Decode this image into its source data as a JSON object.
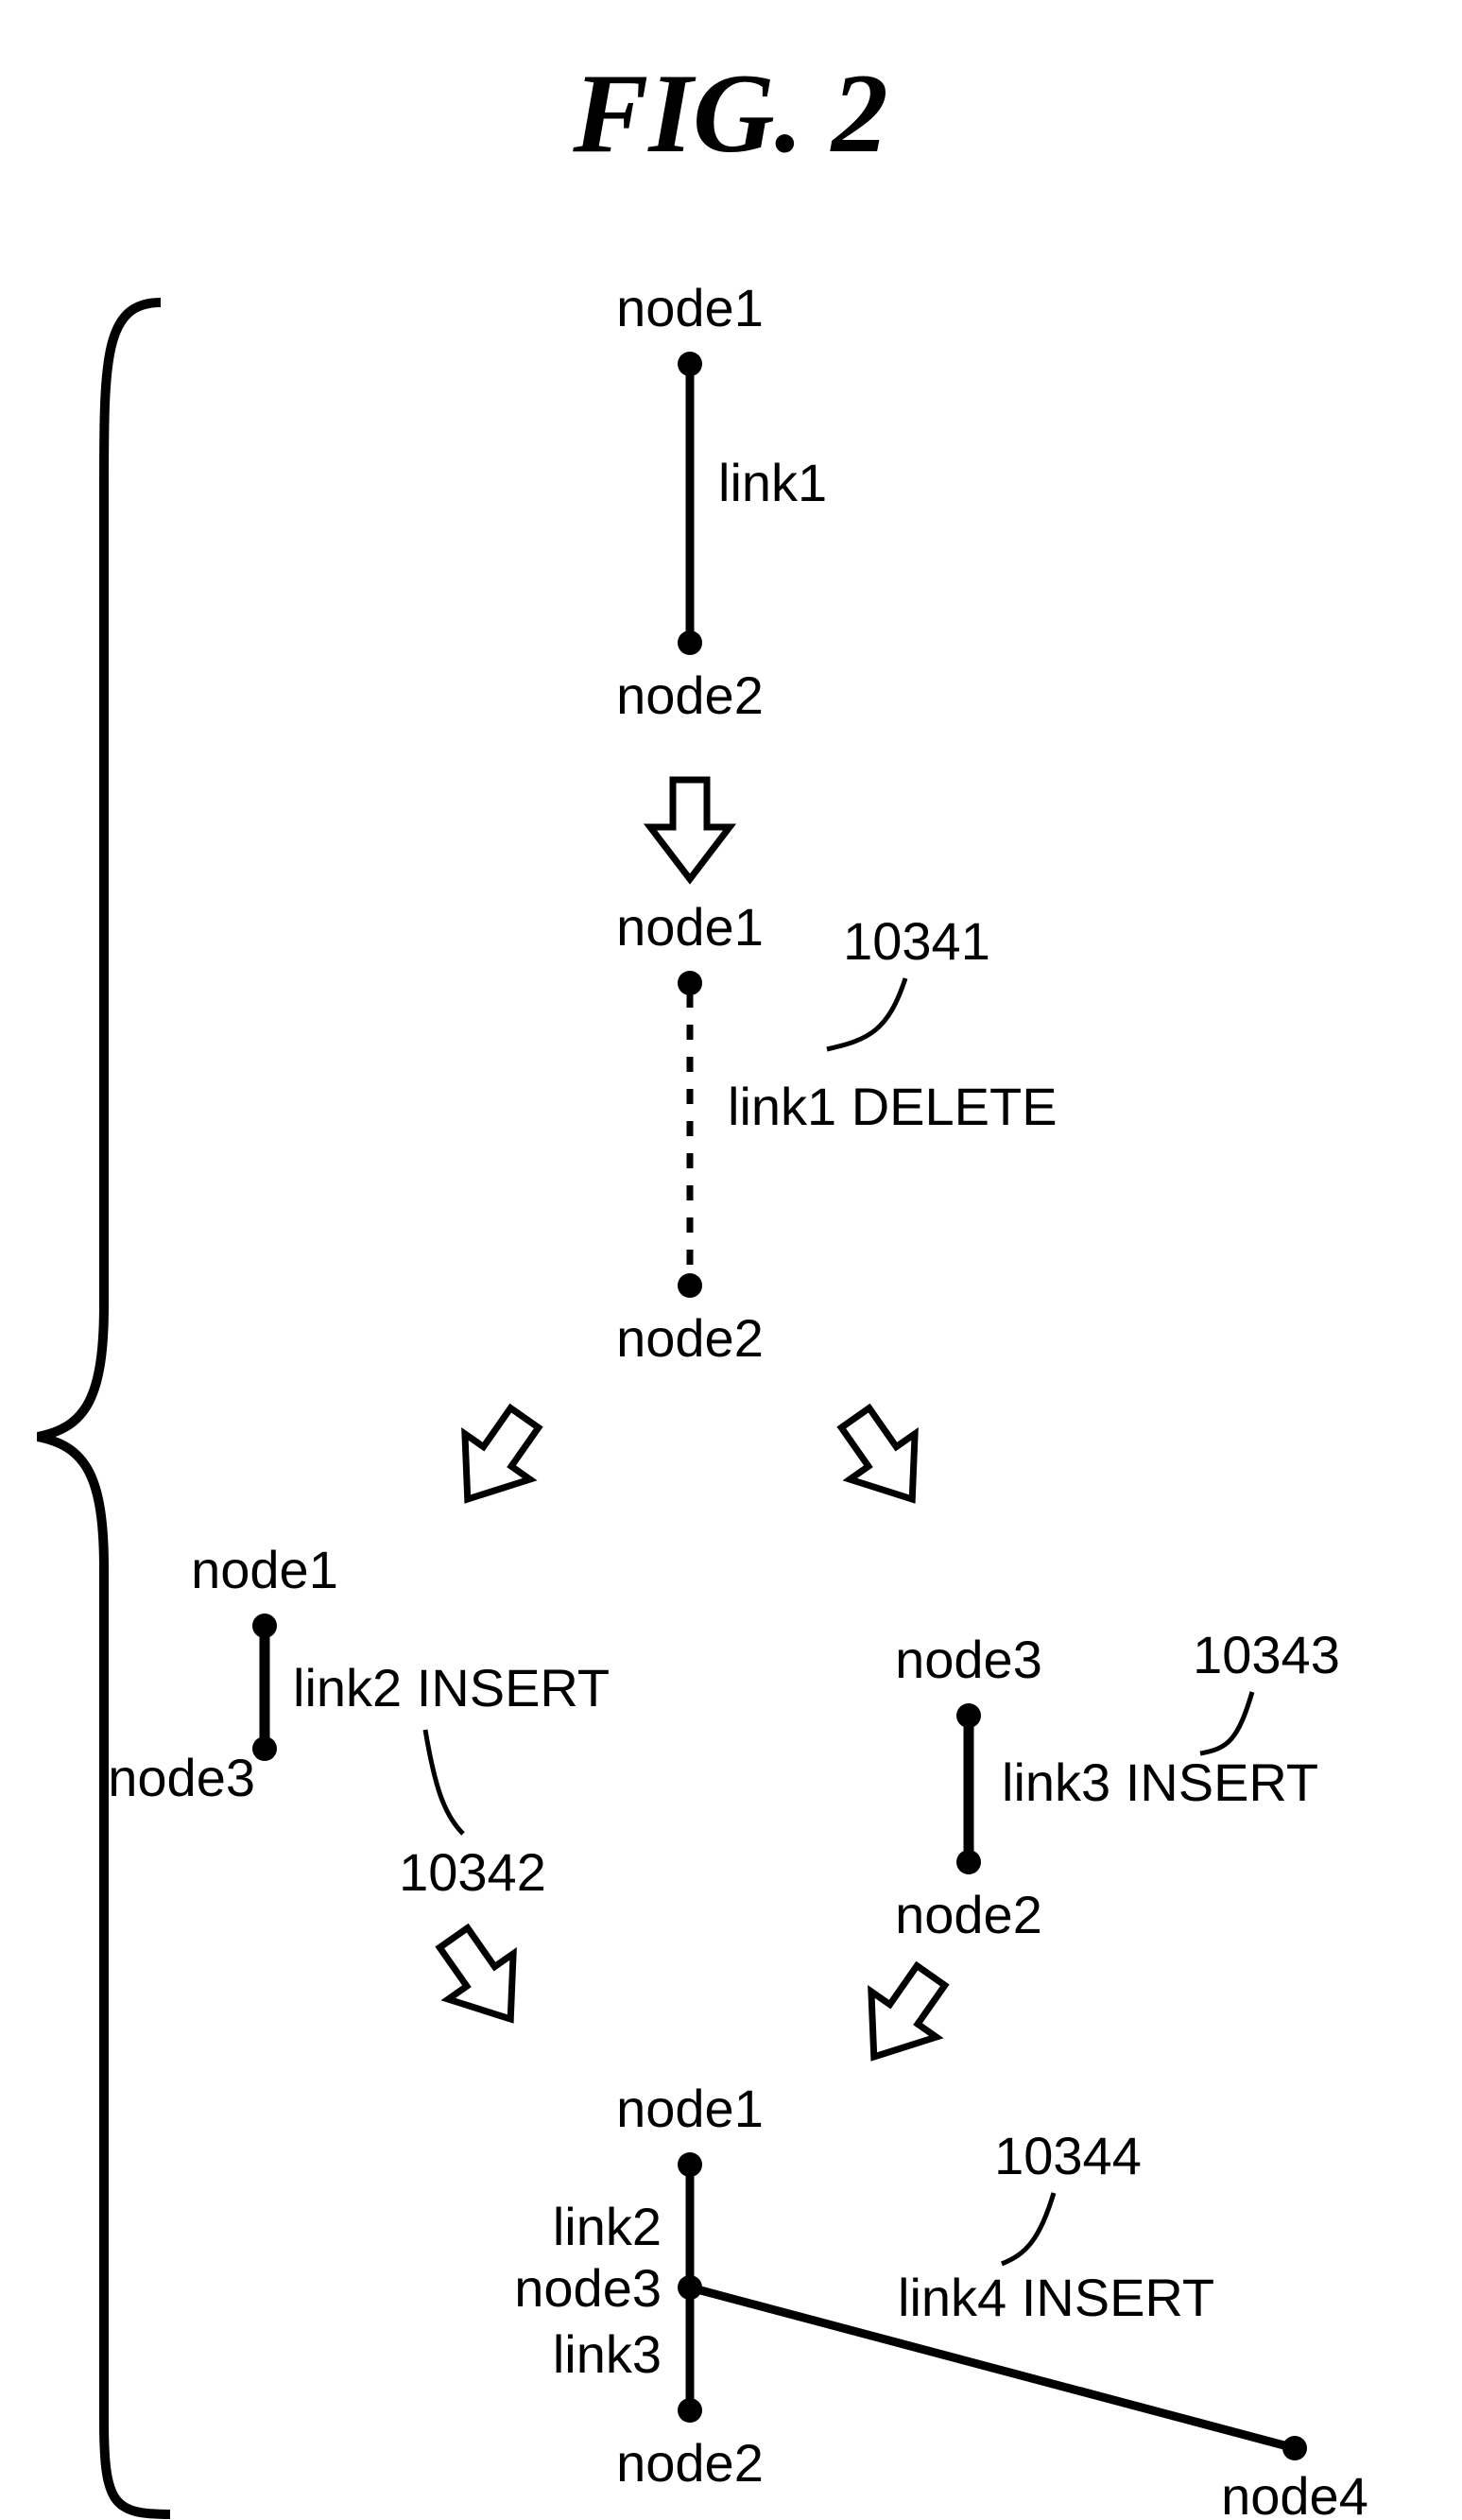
{
  "figure": {
    "title": "FIG.  2",
    "stage1": {
      "node_top": "node1",
      "node_bottom": "node2",
      "link": "link1"
    },
    "stage2": {
      "node_top": "node1",
      "node_bottom": "node2",
      "operation": "link1 DELETE",
      "ref": "10341"
    },
    "stage3_left": {
      "node_top": "node1",
      "node_bottom": "node3",
      "operation": "link2 INSERT",
      "ref": "10342"
    },
    "stage3_right": {
      "node_top": "node3",
      "node_bottom": "node2",
      "operation": "link3 INSERT",
      "ref": "10343"
    },
    "stage4": {
      "node_top": "node1",
      "node_mid": "node3",
      "node_bottom": "node2",
      "node_right": "node4",
      "link_upper": "link2",
      "link_lower": "link3",
      "operation": "link4 INSERT",
      "ref": "10344"
    }
  }
}
